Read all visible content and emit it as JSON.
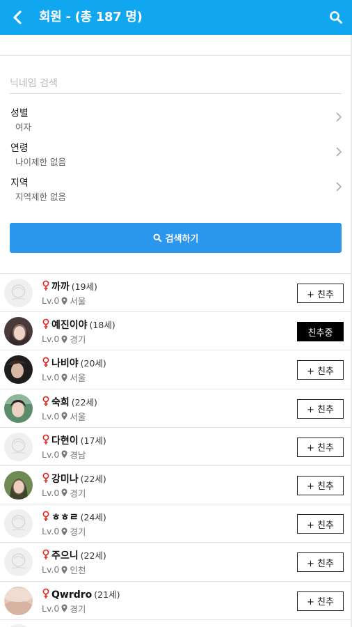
{
  "header": {
    "title": "회원 - (총 187 명)",
    "color": "#10a6f0"
  },
  "search": {
    "placeholder": "닉네임 검색",
    "button_label": "검색하기"
  },
  "filters": [
    {
      "label": "성별",
      "value": "여자"
    },
    {
      "label": "연령",
      "value": "나이제한 없음"
    },
    {
      "label": "지역",
      "value": "지역제한 없음"
    }
  ],
  "members": [
    {
      "nick": "까까",
      "age": "(19세)",
      "level": "Lv.0",
      "region": "서울",
      "button": "+ 친추",
      "following": false,
      "avatar": "noimg"
    },
    {
      "nick": "예진이야",
      "age": "(18세)",
      "level": "Lv.0",
      "region": "경기",
      "button": "친추중",
      "following": true,
      "avatar": "photo1"
    },
    {
      "nick": "나비야",
      "age": "(20세)",
      "level": "Lv.0",
      "region": "서울",
      "button": "+ 친추",
      "following": false,
      "avatar": "photo2"
    },
    {
      "nick": "숙희",
      "age": "(22세)",
      "level": "Lv.0",
      "region": "서울",
      "button": "+ 친추",
      "following": false,
      "avatar": "photo3"
    },
    {
      "nick": "다현이",
      "age": "(17세)",
      "level": "Lv.0",
      "region": "경남",
      "button": "+ 친추",
      "following": false,
      "avatar": "noimg"
    },
    {
      "nick": "강미나",
      "age": "(22세)",
      "level": "Lv.0",
      "region": "경기",
      "button": "+ 친추",
      "following": false,
      "avatar": "photo4"
    },
    {
      "nick": "ㅎㅎㄹ",
      "age": "(24세)",
      "level": "Lv.0",
      "region": "경기",
      "button": "+ 친추",
      "following": false,
      "avatar": "noimg"
    },
    {
      "nick": "주으니",
      "age": "(22세)",
      "level": "Lv.0",
      "region": "인천",
      "button": "+ 친추",
      "following": false,
      "avatar": "noimg"
    },
    {
      "nick": "Qwrdro",
      "age": "(21세)",
      "level": "Lv.0",
      "region": "경기",
      "button": "+ 친추",
      "following": false,
      "avatar": "photo5"
    }
  ],
  "icons": {
    "back": "chevron-left-icon",
    "search": "search-icon",
    "female": "female-icon",
    "location": "map-pin-icon",
    "chevron": "chevron-right-icon"
  }
}
